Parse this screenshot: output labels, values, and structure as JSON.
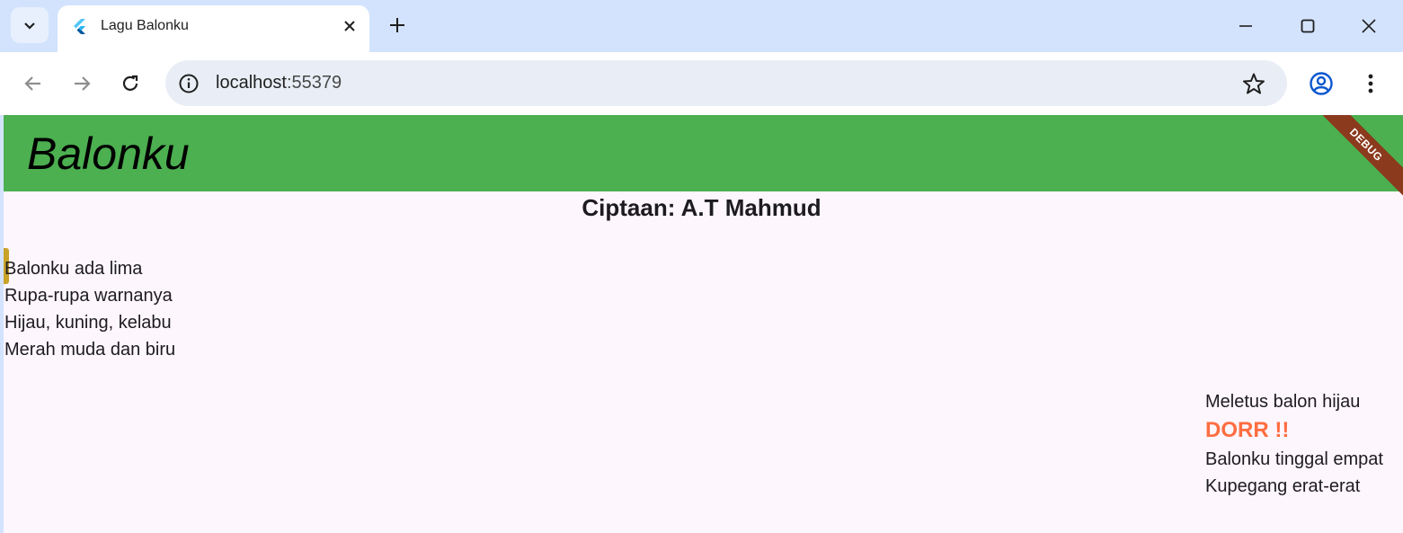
{
  "browser": {
    "tab_title": "Lagu Balonku",
    "url_host": "localhost",
    "url_port": ":55379"
  },
  "app": {
    "title": "Balonku",
    "debug_label": "DEBUG",
    "subtitle": "Ciptaan: A.T Mahmud",
    "verse1": [
      "Balonku ada lima",
      "Rupa-rupa warnanya",
      "Hijau, kuning, kelabu",
      "Merah muda dan biru"
    ],
    "verse2": {
      "line1": "Meletus balon hijau",
      "shout": "DORR !!",
      "line3": "Balonku tinggal empat",
      "line4": "Kupegang erat-erat"
    }
  },
  "colors": {
    "appbar": "#4caf50",
    "accent": "#ff6e40",
    "background": "#fdf6fd"
  }
}
